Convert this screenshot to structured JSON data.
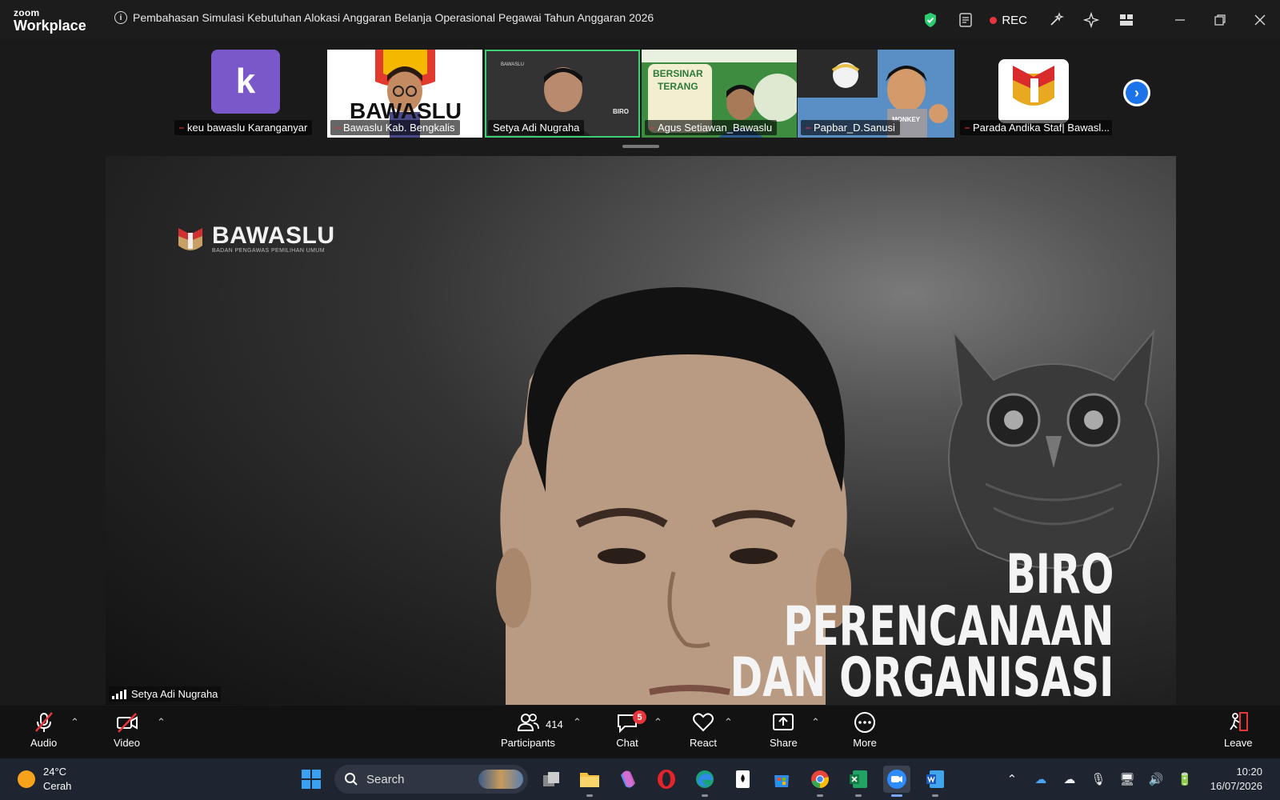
{
  "app": {
    "brand_small": "zoom",
    "brand_large": "Workplace"
  },
  "meeting": {
    "title": "Pembahasan Simulasi Kebutuhan Alokasi Anggaran Belanja Operasional Pegawai Tahun Anggaran 2026",
    "rec_label": "REC"
  },
  "participants_strip": [
    {
      "name": "keu bawaslu Karanganyar",
      "avatar_letter": "k",
      "muted": true
    },
    {
      "name": "Bawaslu Kab. Bengkalis",
      "muted": true
    },
    {
      "name": "Setya Adi Nugraha",
      "muted": false,
      "active": true
    },
    {
      "name": "Agus Setiawan_Bawaslu",
      "muted": true
    },
    {
      "name": "Papbar_D.Sanusi",
      "muted": true
    },
    {
      "name": "Parada Andika Staf| Bawasl...",
      "muted": true
    }
  ],
  "main_video": {
    "speaker_name": "Setya Adi Nugraha",
    "background_logo_text": "BAWASLU",
    "background_logo_subtext": "BADAN PENGAWAS PEMILIHAN UMUM",
    "background_text": [
      "BIRO",
      "PERENCANAAN",
      "DAN ORGANISASI"
    ],
    "thumb_logo_text": "BAWASLU",
    "thumb_banner_text": [
      "BERSINAR",
      "TERANG"
    ],
    "thumb_shirt_text": "MONKEY"
  },
  "toolbar": {
    "audio": "Audio",
    "video": "Video",
    "participants": "Participants",
    "participants_count": "414",
    "chat": "Chat",
    "chat_badge": "5",
    "react": "React",
    "share": "Share",
    "more": "More",
    "leave": "Leave"
  },
  "taskbar": {
    "temperature": "24°C",
    "weather": "Cerah",
    "search_placeholder": "Search",
    "time": "10:20",
    "date": "16/07/2026"
  },
  "colors": {
    "active_border": "#3ecf72",
    "mute_red": "#e8343b",
    "k_avatar": "#7b58c9",
    "next_blue": "#1a73e8"
  }
}
